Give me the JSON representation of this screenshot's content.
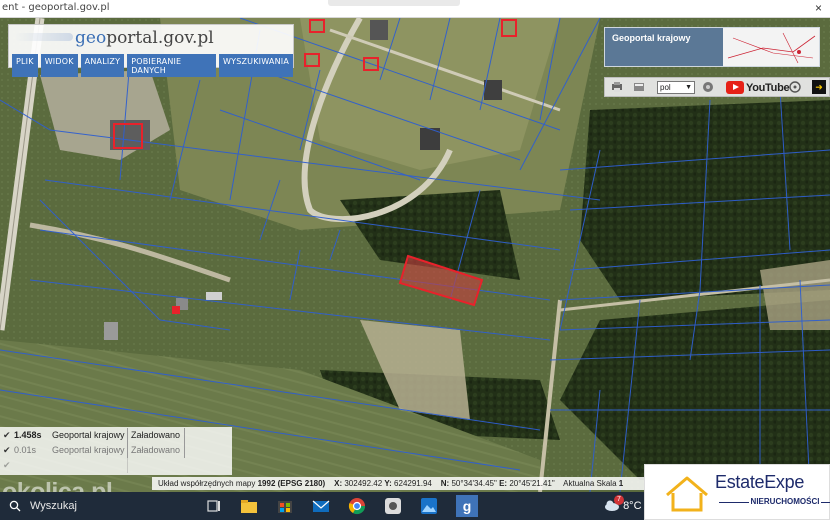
{
  "browser": {
    "title": "ent - geoportal.gov.pl",
    "close_glyph": "×"
  },
  "header": {
    "logo_prefix": "geo",
    "logo_rest": "portal.gov.pl",
    "menu": [
      "PLIK",
      "WIDOK",
      "ANALIZY",
      "POBIERANIE DANYCH",
      "WYSZUKIWANIA"
    ]
  },
  "overview": {
    "title": "Geoportal krajowy"
  },
  "toolbar": {
    "language": "pol",
    "youtube_label": "YouTube",
    "icons": [
      "print-icon",
      "scanner-icon",
      "globe-icon",
      "compass-icon",
      "grid-icon",
      "arrow-right-icon"
    ]
  },
  "log": {
    "rows": [
      {
        "time": "1.458s",
        "source": "Geoportal krajowy",
        "status": "Załadowano"
      },
      {
        "time": "0.01s",
        "source": "Geoportal krajowy",
        "status": "Załadowano"
      }
    ]
  },
  "coords": {
    "label": "Układ współrzędnych mapy",
    "system": "1992 (EPSG 2180)",
    "x_label": "X:",
    "x": "302492.42",
    "y_label": "Y:",
    "y": "624291.94",
    "n_label": "N:",
    "n": "50°34'34.45\"",
    "e_label": "E:",
    "e": "20°45'21.41\"",
    "scale_label": "Aktualna Skala",
    "scale": "1"
  },
  "brand": {
    "name": "EstateExpe",
    "subtitle": "NIERUCHOMOŚCI"
  },
  "watermark": "okolica.pl",
  "taskbar": {
    "search_label": "Wyszukaj",
    "temperature": "8°C",
    "weather_badge": "7"
  },
  "colors": {
    "parcel_outline": "#2f5fd0",
    "highlight": "#e8222b",
    "menu_blue": "#3f73b8",
    "brand_navy": "#1e2b6b"
  }
}
